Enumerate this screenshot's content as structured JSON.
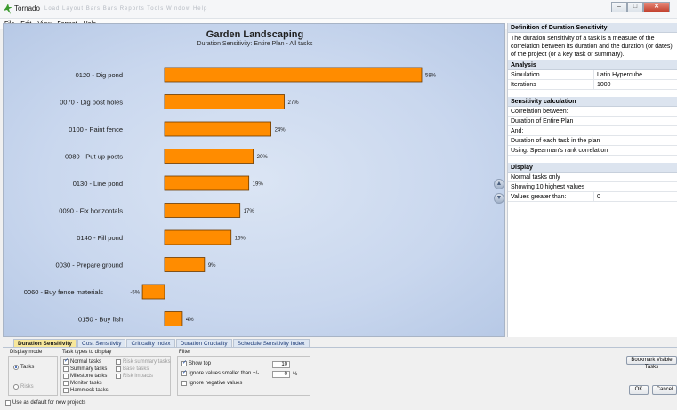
{
  "window": {
    "title": "Tornado",
    "ghost_menu": "Load   Layout   Bars   Bars   Reports   Tools   Window   Help"
  },
  "menubar": {
    "items": [
      "File",
      "Edit",
      "View",
      "Format",
      "Help"
    ]
  },
  "chart_data": {
    "type": "bar",
    "title": "Garden Landscaping",
    "subtitle": "Duration Sensitivity: Entire Plan - All tasks",
    "categories": [
      "0120 - Dig pond",
      "0070 - Dig post holes",
      "0100 - Paint fence",
      "0080 - Put up posts",
      "0130 - Line pond",
      "0090 - Fix horizontals",
      "0140 - Fill pond",
      "0030 - Prepare ground",
      "0060 - Buy fence materials",
      "0150 - Buy fish"
    ],
    "values": [
      58,
      27,
      24,
      20,
      19,
      17,
      15,
      9,
      -5,
      4
    ],
    "value_labels": [
      "58%",
      "27%",
      "24%",
      "20%",
      "19%",
      "17%",
      "15%",
      "9%",
      "-5%",
      "4%"
    ],
    "orientation": "horizontal",
    "bar_color": "#ff8c00",
    "xlim": [
      -10,
      60
    ],
    "grid": false
  },
  "nav": {
    "up_label": "▲",
    "down_label": "▼"
  },
  "right_panel": {
    "definition_title": "Definition of Duration Sensitivity",
    "definition_text": "The duration sensitivity of a task is a measure of the correlation between its duration and the duration (or dates) of the project (or a key task or summary).",
    "analysis_title": "Analysis",
    "analysis_rows": [
      {
        "key": "Simulation",
        "value": "Latin Hypercube"
      },
      {
        "key": "Iterations",
        "value": "1000"
      }
    ],
    "calc_title": "Sensitivity calculation",
    "calc_rows": [
      "Correlation between:",
      "Duration of Entire Plan",
      "And:",
      "Duration of each task in the plan",
      "Using: Spearman's rank correlation"
    ],
    "display_title": "Display",
    "display_rows": [
      "Normal tasks only",
      "Showing 10 highest values"
    ],
    "display_value_row": {
      "key": "Values greater than:",
      "value": "0"
    }
  },
  "tabs": [
    "Duration Sensitivity",
    "Cost Sensitivity",
    "Criticality Index",
    "Duration Cruciality",
    "Schedule Sensitivity Index"
  ],
  "bottom": {
    "display_mode_label": "Display mode",
    "tasks_radio": "Tasks",
    "risks_radio": "Risks",
    "task_types_label": "Task types to display",
    "task_types_col1": [
      {
        "label": "Normal tasks",
        "checked": true
      },
      {
        "label": "Summary tasks",
        "checked": false
      },
      {
        "label": "Milestone tasks",
        "checked": false
      },
      {
        "label": "Monitor tasks",
        "checked": false
      },
      {
        "label": "Hammock tasks",
        "checked": false
      }
    ],
    "task_types_col2": [
      "Risk summary tasks",
      "Base tasks",
      "Risk impacts"
    ],
    "filter_label": "Filter",
    "show_top_label": "Show top",
    "show_top_value": "10",
    "ignore_small_label": "Ignore values smaller than +/-",
    "ignore_small_value": "0",
    "ignore_small_unit": "%",
    "ignore_negative_label": "Ignore negative values",
    "bookmark_button": "Bookmark Visible Tasks",
    "default_label": "Use as default for new projects",
    "ok_button": "OK",
    "cancel_button": "Cancel"
  }
}
